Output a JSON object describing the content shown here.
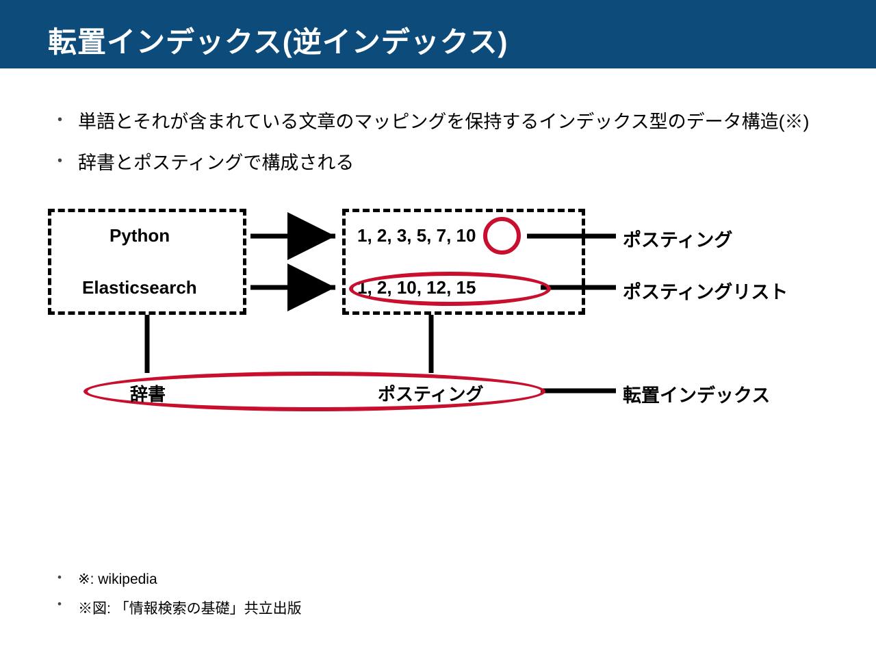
{
  "header": {
    "title": "転置インデックス(逆インデックス)"
  },
  "bullets": {
    "main": [
      "単語とそれが含まれている文章のマッピングを保持するインデックス型のデータ構造(※)",
      "辞書とポスティングで構成される"
    ],
    "foot": [
      "※: wikipedia",
      "※図: 「情報検索の基礎」共立出版"
    ]
  },
  "terms": {
    "t1": "Python",
    "t2": "Elasticsearch",
    "p1": "1, 2, 3, 5, 7, 10",
    "p2": "1, 2, 10, 12, 15"
  },
  "labels": {
    "posting": "ポスティング",
    "posting_list": "ポスティングリスト",
    "inverted_index": "転置インデックス",
    "dict": "辞書",
    "posting_b": "ポスティング"
  },
  "colors": {
    "header_bg": "#0d4c7a",
    "accent_red": "#c8102e"
  }
}
